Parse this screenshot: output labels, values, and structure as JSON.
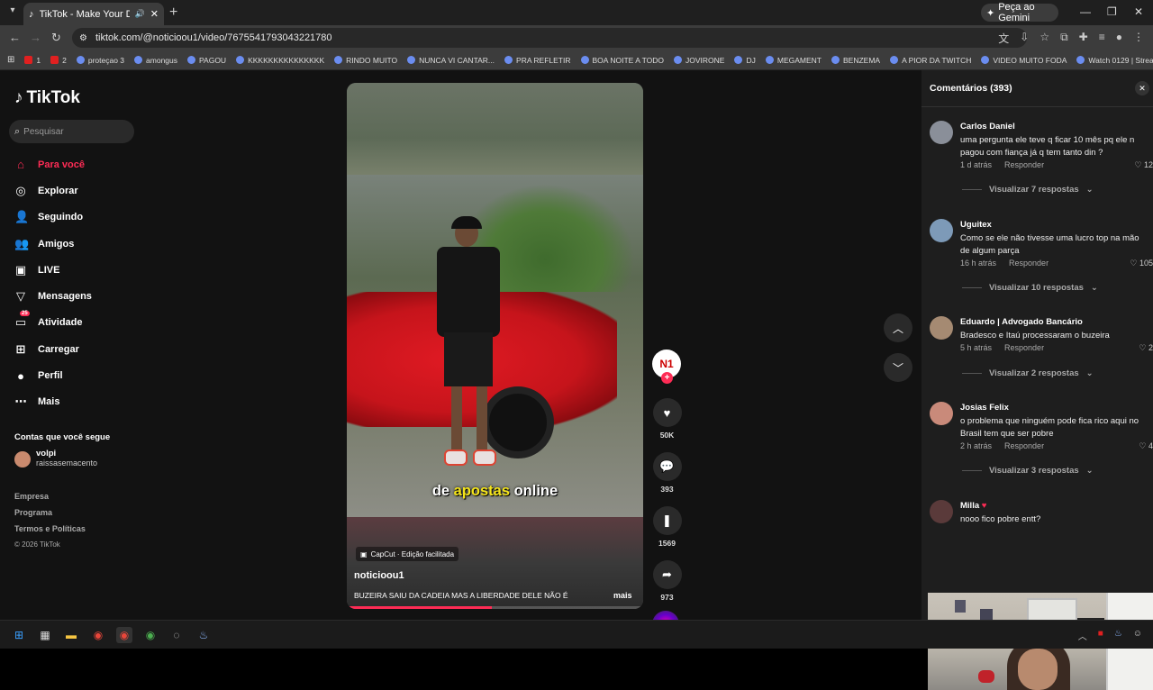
{
  "browser": {
    "tab_title": "TikTok - Make Your Day",
    "gemini_label": "Peça ao Gemini",
    "url": "tiktok.com/@noticioou1/video/7675541793043221780",
    "bookmarks": [
      "1",
      "2",
      "proteçao 3",
      "amongus",
      "PAGOU",
      "KKKKKKKKKKKKKKK",
      "RINDO MUITO",
      "NUNCA VI CANTAR...",
      "PRA REFLETIR",
      "BOA NOITE A TODO",
      "JOVIRONE",
      "DJ",
      "MEGAMENT",
      "BENZEMA",
      "A PIOR DA TWITCH",
      "VIDEO MUITO FODA",
      "Watch 0129 | Strea..."
    ]
  },
  "sidebar": {
    "logo": "TikTok",
    "search_placeholder": "Pesquisar",
    "nav": [
      "Para você",
      "Explorar",
      "Seguindo",
      "Amigos",
      "LIVE",
      "Mensagens",
      "Atividade",
      "Carregar",
      "Perfil",
      "Mais"
    ],
    "activity_badge": "25",
    "following_heading": "Contas que você segue",
    "following_user_name": "volpi",
    "following_user_handle": "raissasemacento",
    "footer": [
      "Empresa",
      "Programa",
      "Termos e Políticas"
    ],
    "copyright": "© 2026 TikTok"
  },
  "video": {
    "caption_pre": "de ",
    "caption_highlight": "apostas",
    "caption_post": " online",
    "capcut_label": "CapCut · Edição facilitada",
    "author": "noticioou1",
    "description": "BUZEIRA SAIU DA CADEIA MAS A LIBERDADE DELE NÃO É",
    "more": "mais",
    "progress": 0.49,
    "creator_avatar": "N1"
  },
  "actions": {
    "likes": "50K",
    "comments": "393",
    "saves": "1569",
    "shares": "973"
  },
  "comments": {
    "title": "Comentários",
    "count": "(393)",
    "items": [
      {
        "name": "Carlos Daniel",
        "text": "uma pergunta ele teve q ficar 10 mês pq ele n pagou com fiança já q tem tanto din ?",
        "time": "1 d atrás",
        "reply": "Responder",
        "likes": "12",
        "replies": "Visualizar 7 respostas",
        "avatar_color": "#8a8f99"
      },
      {
        "name": "Uguitex",
        "text": "Como se ele não tivesse uma lucro top na mão de algum parça",
        "time": "16 h atrás",
        "reply": "Responder",
        "likes": "105",
        "replies": "Visualizar 10 respostas",
        "avatar_color": "#7d9ab8"
      },
      {
        "name": "Eduardo | Advogado Bancário",
        "text": "Bradesco e Itaú processaram o buzeira",
        "time": "5 h atrás",
        "reply": "Responder",
        "likes": "2",
        "replies": "Visualizar 2 respostas",
        "avatar_color": "#a58a72"
      },
      {
        "name": "Josias Felix",
        "text": "o problema que ninguém pode fica rico aqui no Brasil tem que ser pobre",
        "time": "2 h atrás",
        "reply": "Responder",
        "likes": "4",
        "replies": "Visualizar 3 respostas",
        "avatar_color": "#c98a7a"
      },
      {
        "name": "Milla",
        "text": "nooo fico pobre entt?",
        "time": "",
        "reply": "",
        "likes": "",
        "replies": "",
        "avatar_color": "#5a3a3a"
      }
    ]
  },
  "colors": {
    "accent": "#fe2c55",
    "caption_highlight": "#f5e51b"
  }
}
